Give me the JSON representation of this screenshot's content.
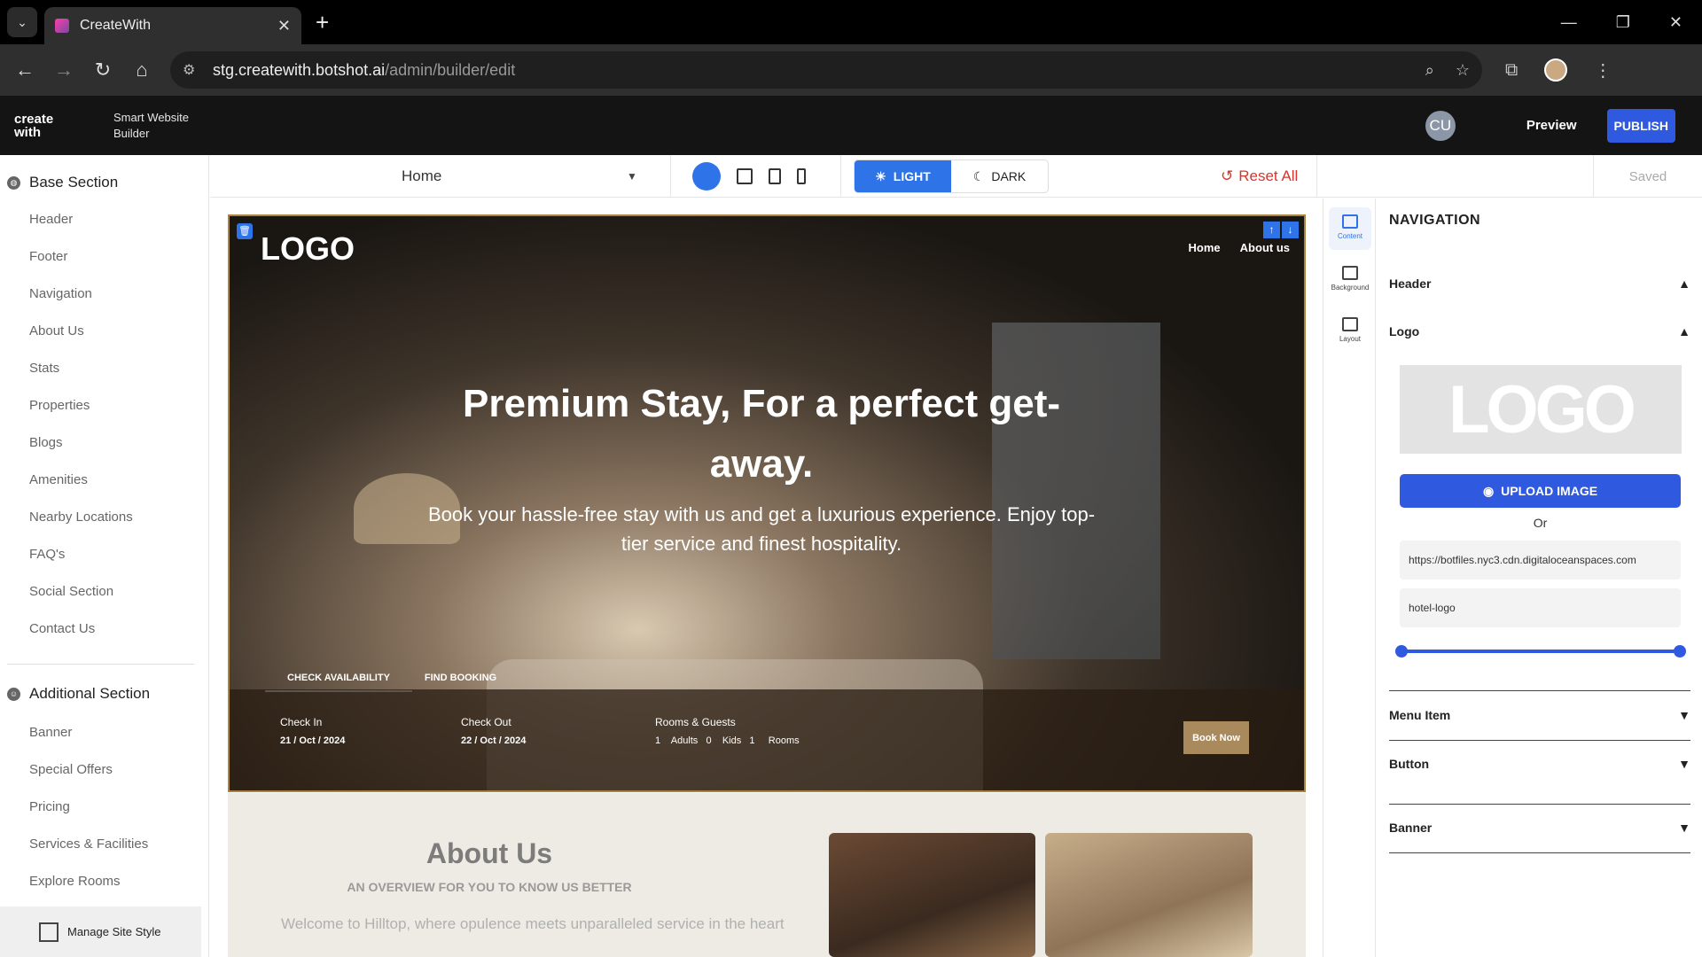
{
  "browser": {
    "tab_title": "CreateWith",
    "url_host": "stg.createwith.botshot.ai",
    "url_path": "/admin/builder/edit"
  },
  "app": {
    "brand": "create with",
    "brand_sub": "Smart Website Builder",
    "user_initials": "CU",
    "preview_label": "Preview",
    "publish_label": "PUBLISH"
  },
  "sidebar": {
    "base_title": "Base Section",
    "base_items": [
      "Header",
      "Footer",
      "Navigation",
      "About Us",
      "Stats",
      "Properties",
      "Blogs",
      "Amenities",
      "Nearby Locations",
      "FAQ's",
      "Social Section",
      "Contact Us"
    ],
    "additional_title": "Additional Section",
    "additional_items": [
      "Banner",
      "Special Offers",
      "Pricing",
      "Services & Facilities",
      "Explore Rooms"
    ],
    "manage_label": "Manage Site Style"
  },
  "toolbar": {
    "page_select": "Home",
    "light_label": "LIGHT",
    "dark_label": "DARK",
    "reset_label": "Reset All",
    "saved_label": "Saved"
  },
  "hero": {
    "logo": "LOGO",
    "nav": [
      "Home",
      "About us"
    ],
    "title": "Premium Stay, For a perfect get-away.",
    "subtitle": "Book your hassle-free stay with us and get a luxurious experience. Enjoy top-tier service and finest hospitality.",
    "tabs": [
      "CHECK AVAILABILITY",
      "FIND BOOKING"
    ],
    "checkin_label": "Check In",
    "checkin_value": "21 / Oct / 2024",
    "checkout_label": "Check Out",
    "checkout_value": "22 / Oct / 2024",
    "rooms_label": "Rooms & Guests",
    "rooms_value": "1    Adults   0    Kids   1     Rooms",
    "book_now": "Book Now"
  },
  "about": {
    "title": "About Us",
    "overview": "AN OVERVIEW FOR YOU TO KNOW US BETTER",
    "welcome": "Welcome to Hilltop, where opulence meets unparalleled service in the heart"
  },
  "rail": {
    "items": [
      "Content",
      "Background",
      "Layout"
    ]
  },
  "panel": {
    "title": "NAVIGATION",
    "header": "Header",
    "logo": "Logo",
    "logo_preview": "LOGO",
    "upload_label": "UPLOAD IMAGE",
    "or_label": "Or",
    "url_value": "https://botfiles.nyc3.cdn.digitaloceanspaces.com",
    "alt_value": "hotel-logo",
    "menu_item": "Menu Item",
    "button": "Button",
    "banner": "Banner"
  },
  "colors": {
    "accent": "#2f73e8",
    "publish": "#2f5ae0",
    "reset": "#d9342b",
    "hero_border": "#a8843f",
    "book_now": "#a88a5c"
  }
}
